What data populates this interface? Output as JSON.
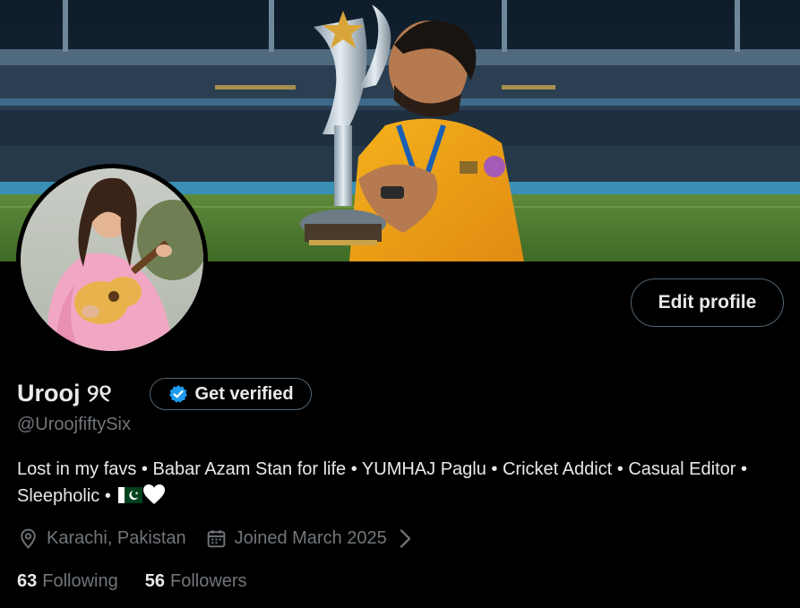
{
  "profile": {
    "display_name": "Urooj ୨୧",
    "handle": "@UroojfiftySix",
    "bio_text": "Lost in my favs • Babar Azam Stan for life • YUMHAJ Paglu • Cricket Addict • Casual Editor • Sleepholic • ",
    "location": "Karachi, Pakistan",
    "joined": "Joined March 2025",
    "following_count": "63",
    "following_label": "Following",
    "followers_count": "56",
    "followers_label": "Followers"
  },
  "actions": {
    "edit_profile": "Edit profile",
    "get_verified": "Get verified"
  },
  "icons": {
    "verified": "verified-badge-icon",
    "location": "location-pin-icon",
    "calendar": "calendar-icon",
    "chevron": "chevron-right-icon",
    "flag": "pakistan-flag-emoji",
    "heart": "white-heart-emoji"
  },
  "colors": {
    "background": "#000000",
    "text_primary": "#e7e9ea",
    "text_secondary": "#71767b",
    "border": "#536471",
    "verified_blue": "#1d9bf0"
  }
}
